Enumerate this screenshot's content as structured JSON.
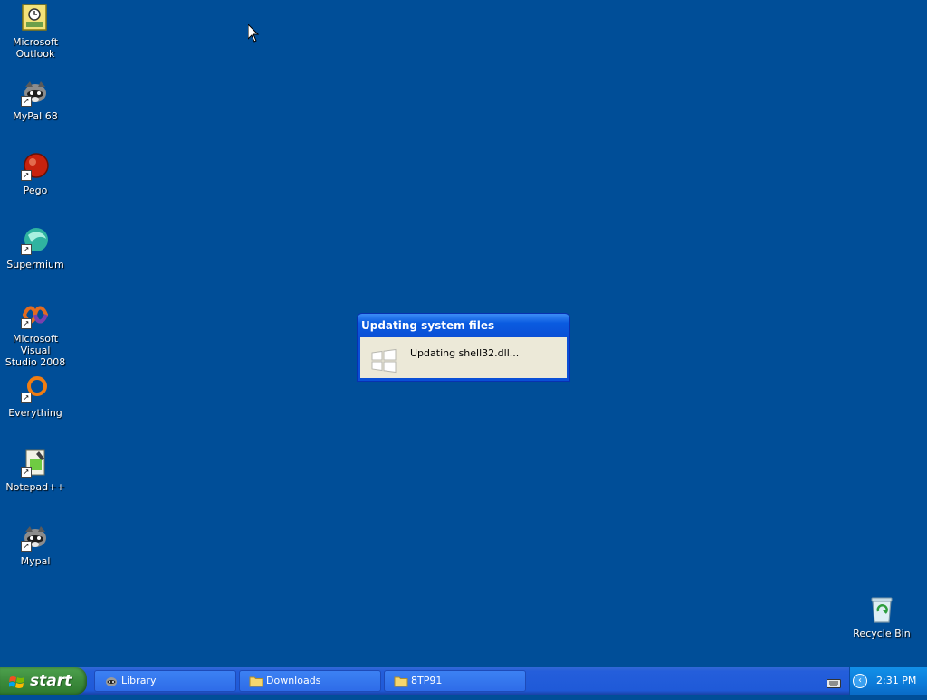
{
  "desktop": {
    "icons": [
      {
        "label": "Microsoft\nOutlook"
      },
      {
        "label": "MyPal 68"
      },
      {
        "label": "Pego"
      },
      {
        "label": "Supermium"
      },
      {
        "label": "Microsoft Visual\nStudio 2008"
      },
      {
        "label": "Everything"
      },
      {
        "label": "Notepad++"
      },
      {
        "label": "Mypal"
      },
      {
        "label": "Recycle Bin"
      }
    ]
  },
  "dialog": {
    "title": "Updating system files",
    "message": "Updating shell32.dll..."
  },
  "taskbar": {
    "start_label": "start",
    "buttons": [
      {
        "label": "Library",
        "icon": "raccoon-icon"
      },
      {
        "label": "Downloads",
        "icon": "folder-icon"
      },
      {
        "label": "8TP91",
        "icon": "folder-icon"
      }
    ],
    "clock": "2:31 PM"
  },
  "colors": {
    "desktop_bg": "#004E98",
    "taskbar_blue": "#245EDB",
    "start_green": "#3C8B3C",
    "dialog_title_blue": "#0A4FD6"
  }
}
